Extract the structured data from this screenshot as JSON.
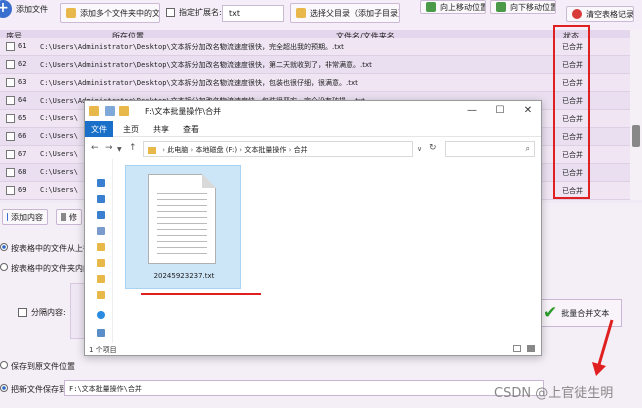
{
  "toolbar": {
    "add_file": "添加文件",
    "add_multi_folder": "添加多个文件夹中的文件",
    "ext_label": "指定扩展名:",
    "ext_value": "txt",
    "select_subdir": "选择父目录（添加子目录）",
    "move_up": "向上移动位置",
    "move_down": "向下移动位置",
    "clear_table": "清空表格记录"
  },
  "table": {
    "headers": [
      "序号",
      "所在位置",
      "文件名/文件夹名",
      "状态"
    ],
    "rows": [
      {
        "num": "61",
        "path": "C:\\Users\\Administrator\\Desktop\\文本拆分加改名\\",
        "name": "物流速度很快，完全超出我的预期。.txt",
        "status": "已合并"
      },
      {
        "num": "62",
        "path": "C:\\Users\\Administrator\\Desktop\\文本拆分加改名\\",
        "name": "物流速度很快，第二天就收到了，非常满意。.txt",
        "status": "已合并"
      },
      {
        "num": "63",
        "path": "C:\\Users\\Administrator\\Desktop\\文本拆分加改名\\",
        "name": "物流速度很快，包装也很仔细，很满意。.txt",
        "status": "已合并"
      },
      {
        "num": "64",
        "path": "C:\\Users\\Administrator\\Desktop\\文本拆分加改名\\",
        "name": "物流速度快，包装很严实，完全没有破损。.txt",
        "status": "已合并"
      },
      {
        "num": "65",
        "path": "C:\\Users\\",
        "name": "",
        "status": "已合并"
      },
      {
        "num": "66",
        "path": "C:\\Users\\",
        "name": "",
        "status": "已合并"
      },
      {
        "num": "67",
        "path": "C:\\Users\\",
        "name": "",
        "status": "已合并"
      },
      {
        "num": "68",
        "path": "C:\\Users\\",
        "name": "",
        "status": "已合并"
      },
      {
        "num": "69",
        "path": "C:\\Users\\",
        "name": "",
        "status": "已合并"
      }
    ]
  },
  "lower": {
    "add_content": "添加内容",
    "modify": "修",
    "opt_same_folder": "按表格中的文件从上往",
    "opt_from_folder": "按表格中的文件夹内的",
    "separator_label": "分隔内容:",
    "batch_merge": "批量合并文本",
    "save_to_original": "保存到原文件位置",
    "save_to_label": "把新文件保存到:",
    "save_path": "F:\\文本批量操作\\合并"
  },
  "dialog": {
    "title": "F:\\文本批量操作\\合并",
    "tabs": [
      "文件",
      "主页",
      "共享",
      "查看"
    ],
    "address": [
      "此电脑",
      "本地磁盘 (F:)",
      "文本批量操作",
      "合并"
    ],
    "file_name": "20245923237.txt",
    "item_count": "1 个项目"
  },
  "watermark": "CSDN @上官徒生明"
}
